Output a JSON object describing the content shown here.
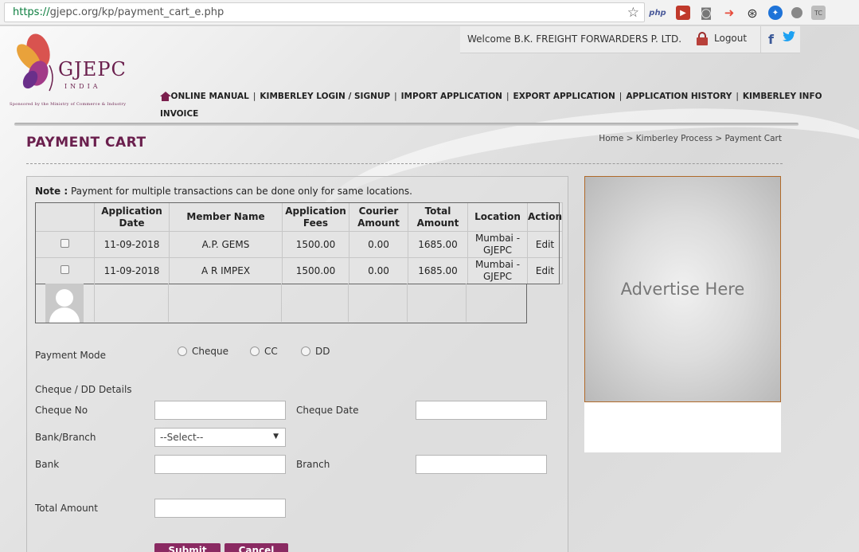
{
  "browser": {
    "url_scheme": "https://",
    "url_rest": "gjepc.org/kp/payment_cart_e.php",
    "extensions": [
      "php-icon",
      "record-icon",
      "camera-icon",
      "arrow-icon",
      "swirl-icon",
      "blue-extension-icon",
      "bubble-icon",
      "tc-icon"
    ],
    "php_label": "php",
    "tc_label": "TC"
  },
  "header": {
    "logo_text": "GJEPC",
    "logo_sub": "INDIA",
    "logo_tagline": "Sponsored by the Ministry of Commerce & Industry",
    "welcome": "Welcome B.K. FREIGHT FORWARDERS P. LTD.",
    "logout": "Logout",
    "facebook": "f"
  },
  "nav": {
    "items": [
      "ONLINE MANUAL",
      "KIMBERLEY LOGIN / SIGNUP",
      "IMPORT APPLICATION",
      "EXPORT APPLICATION",
      "APPLICATION HISTORY",
      "KIMBERLEY INFO",
      "INVOICE"
    ]
  },
  "page": {
    "title": "PAYMENT CART",
    "breadcrumb": "Home > Kimberley Process > Payment Cart"
  },
  "note": {
    "label": "Note :",
    "text": " Payment for multiple transactions can be done only for same locations."
  },
  "table": {
    "headers": [
      "",
      "Application Date",
      "Member Name",
      "Application Fees",
      "Courier Amount",
      "Total Amount",
      "Location",
      "Action"
    ],
    "rows": [
      {
        "date": "11-09-2018",
        "member": "A.P. GEMS",
        "fees": "1500.00",
        "courier": "0.00",
        "total": "1685.00",
        "location": "Mumbai - GJEPC",
        "action": "Edit"
      },
      {
        "date": "11-09-2018",
        "member": "A R IMPEX",
        "fees": "1500.00",
        "courier": "0.00",
        "total": "1685.00",
        "location": "Mumbai - GJEPC",
        "action": "Edit"
      }
    ]
  },
  "form": {
    "payment_mode_label": "Payment Mode",
    "modes": [
      "Cheque",
      "CC",
      "DD"
    ],
    "details_label": "Cheque / DD Details",
    "cheque_no_label": "Cheque No",
    "cheque_date_label": "Cheque Date",
    "bank_branch_label": "Bank/Branch",
    "bank_branch_select": "--Select--",
    "bank_label": "Bank",
    "branch_label": "Branch",
    "total_amount_label": "Total Amount",
    "submit": "Submit",
    "cancel": "Cancel"
  },
  "advert": {
    "text": "Advertise Here"
  },
  "colors": {
    "brand": "#6a1f4d",
    "button": "#8a2a62",
    "url_green": "#0b7d3e"
  }
}
